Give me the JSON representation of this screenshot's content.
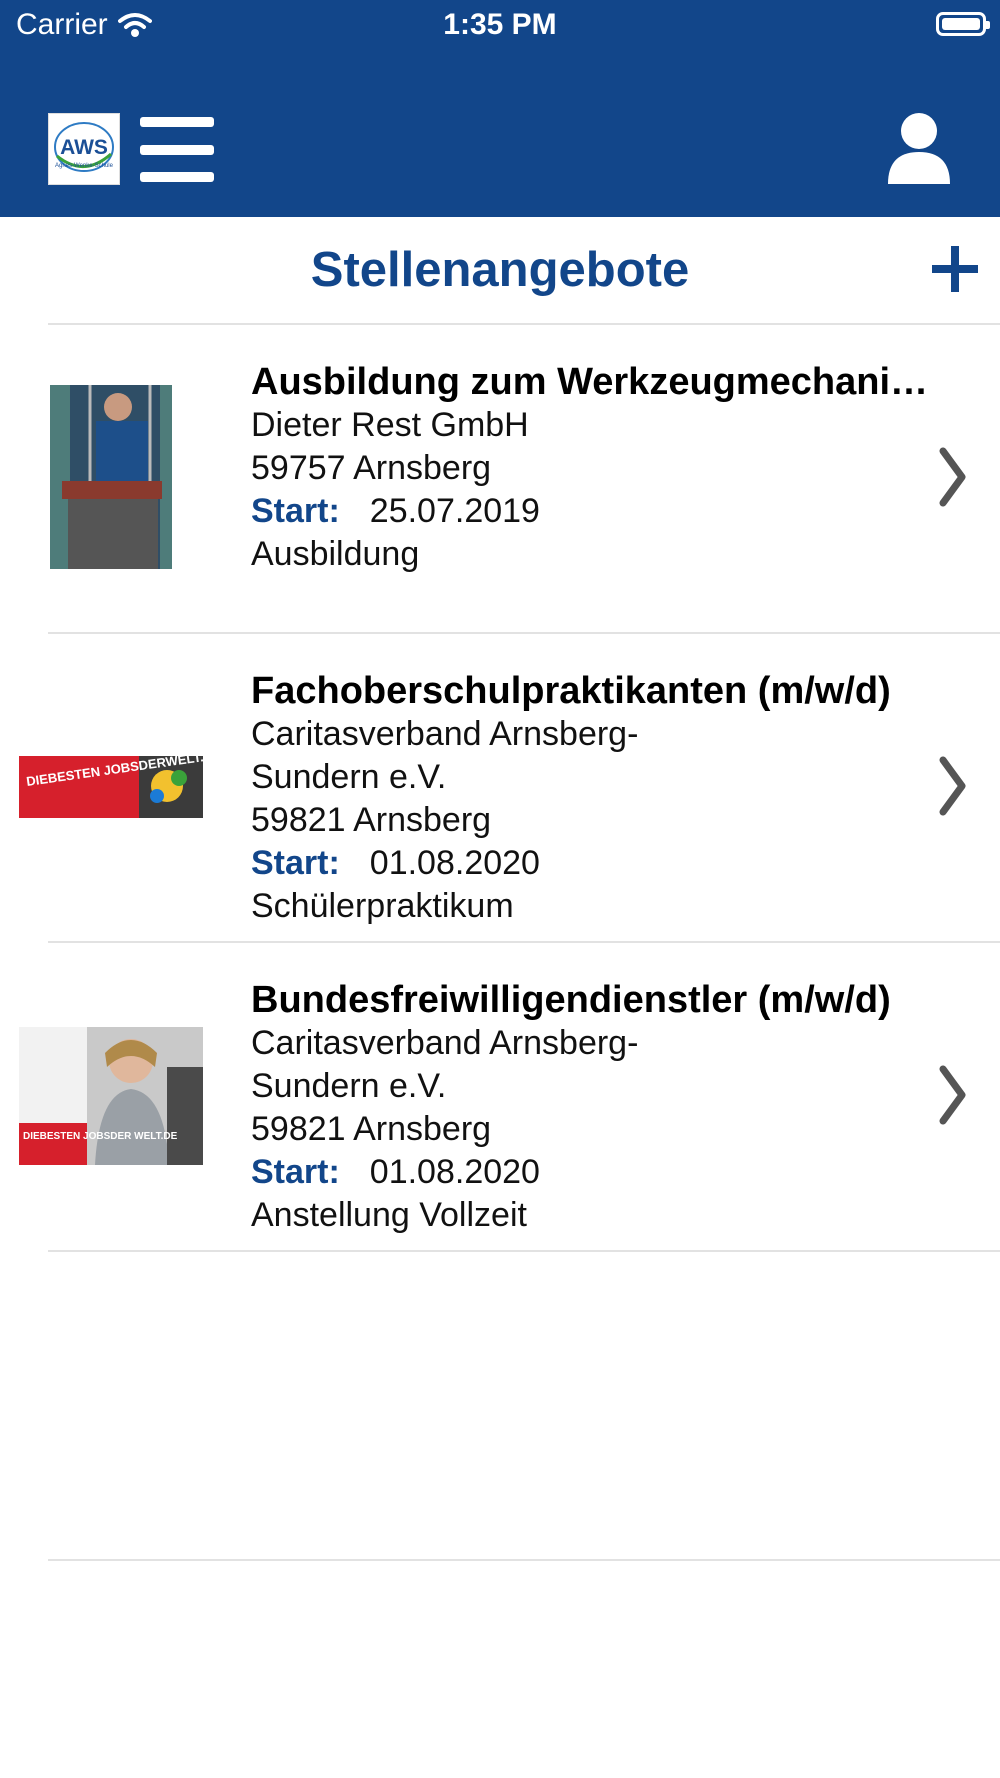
{
  "status_bar": {
    "carrier": "Carrier",
    "time": "1:35 PM"
  },
  "header": {
    "logo_text": "AWS",
    "logo_subtext": "Agnes-Wenke-Schule"
  },
  "page": {
    "title": "Stellenangebote"
  },
  "jobs": [
    {
      "title": "Ausbildung zum Werkzeugmechaniker",
      "company_line1": "Dieter Rest GmbH",
      "company_line2": "",
      "location": "59757 Arnsberg",
      "start_label": "Start:",
      "start_date": "25.07.2019",
      "type": "Ausbildung"
    },
    {
      "title": "Fachoberschulpraktikanten (m/w/d)",
      "company_line1": "Caritasverband Arnsberg-",
      "company_line2": "Sundern e.V.",
      "location": "59821 Arnsberg",
      "start_label": "Start:",
      "start_date": "01.08.2020",
      "type": "Schülerpraktikum",
      "image_text": "DIEBESTEN JOBSDERWELT.DE"
    },
    {
      "title": "Bundesfreiwilligendienstler (m/w/d)",
      "company_line1": "Caritasverband Arnsberg-",
      "company_line2": "Sundern e.V.",
      "location": "59821 Arnsberg",
      "start_label": "Start:",
      "start_date": "01.08.2020",
      "type": "Anstellung Vollzeit",
      "image_text": "DIEBESTEN JOBSDER WELT.DE"
    }
  ],
  "colors": {
    "brand": "#12468a",
    "divider": "#e2e2e2",
    "chevron": "#555555"
  }
}
